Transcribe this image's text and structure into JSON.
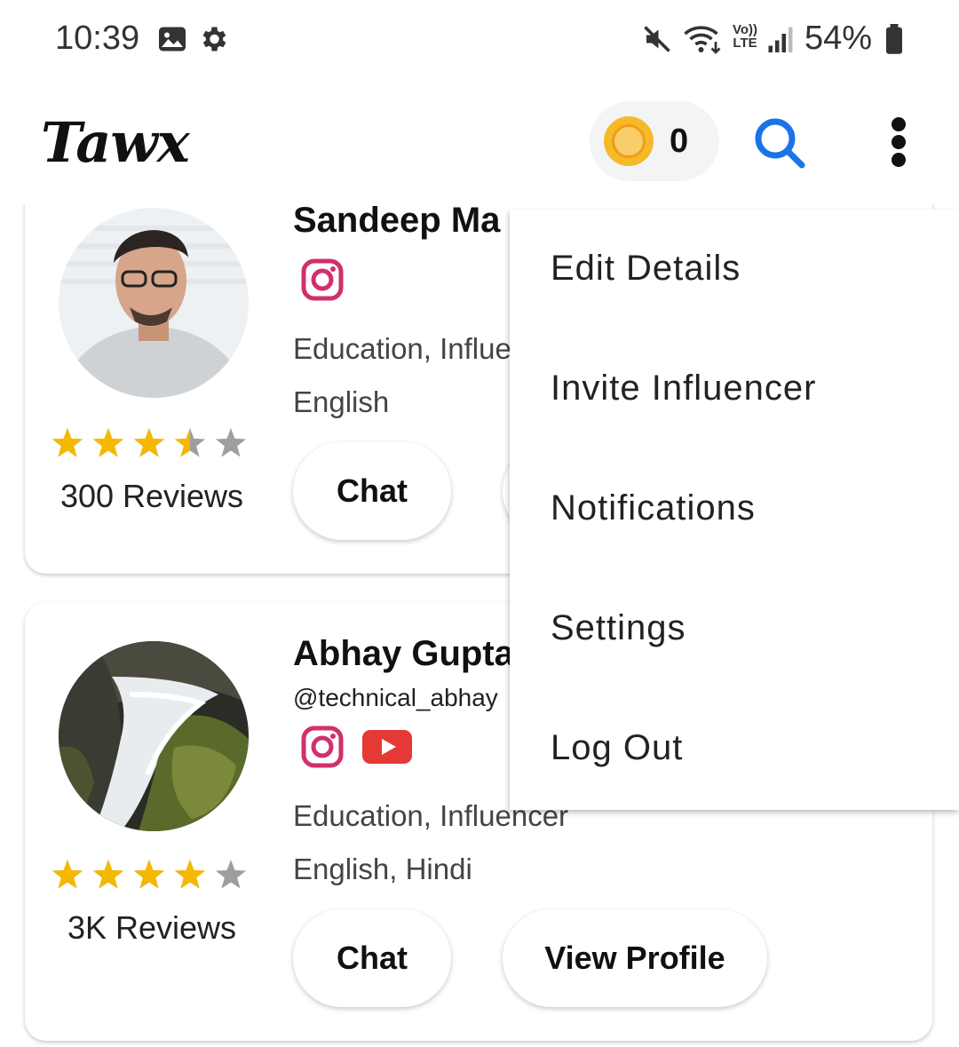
{
  "status_bar": {
    "time": "10:39",
    "battery": "54%",
    "left_icons": [
      "gallery-icon",
      "gear-icon"
    ],
    "right_icons": [
      "mute-icon",
      "wifi-icon",
      "volte-icon",
      "signal-icon",
      "battery-icon"
    ],
    "volte_top": "Vo))",
    "volte_bottom": "LTE"
  },
  "app_bar": {
    "logo": "Tawx",
    "coin_count": "0",
    "accent": "#1a73e8"
  },
  "creators": [
    {
      "name": "Sandeep Ma",
      "handle": "",
      "socials": [
        "instagram-icon"
      ],
      "category": "Education, Influe",
      "languages": "English",
      "rating": 3.5,
      "reviews": "300 Reviews",
      "chat_label": "Chat"
    },
    {
      "name": "Abhay Gupta",
      "handle": "@technical_abhay",
      "socials": [
        "instagram-icon",
        "youtube-icon"
      ],
      "category": "Education, Influencer",
      "languages": "English, Hindi",
      "rating": 4,
      "reviews": "3K Reviews",
      "chat_label": "Chat",
      "profile_label": "View Profile"
    }
  ],
  "menu": {
    "items": [
      "Edit Details",
      "Invite Influencer",
      "Notifications",
      "Settings",
      "Log Out"
    ]
  },
  "colors": {
    "star_filled": "#f5b800",
    "star_empty": "#9e9e9e",
    "instagram": "#d1306c",
    "youtube": "#e53935"
  }
}
